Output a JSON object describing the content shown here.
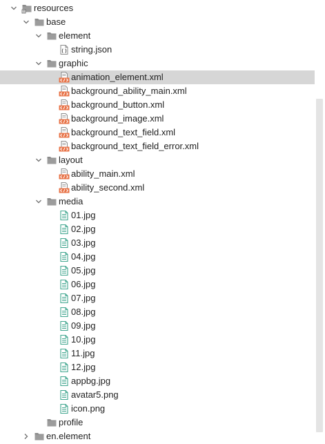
{
  "tree": [
    {
      "label": "resources",
      "level": 0,
      "kind": "folder-root",
      "expanded": true
    },
    {
      "label": "base",
      "level": 1,
      "kind": "folder",
      "expanded": true
    },
    {
      "label": "element",
      "level": 2,
      "kind": "folder",
      "expanded": true
    },
    {
      "label": "string.json",
      "level": 3,
      "kind": "json"
    },
    {
      "label": "graphic",
      "level": 2,
      "kind": "folder",
      "expanded": true
    },
    {
      "label": "animation_element.xml",
      "level": 3,
      "kind": "xml",
      "selected": true
    },
    {
      "label": "background_ability_main.xml",
      "level": 3,
      "kind": "xml"
    },
    {
      "label": "background_button.xml",
      "level": 3,
      "kind": "xml"
    },
    {
      "label": "background_image.xml",
      "level": 3,
      "kind": "xml"
    },
    {
      "label": "background_text_field.xml",
      "level": 3,
      "kind": "xml"
    },
    {
      "label": "background_text_field_error.xml",
      "level": 3,
      "kind": "xml"
    },
    {
      "label": "layout",
      "level": 2,
      "kind": "folder",
      "expanded": true
    },
    {
      "label": "ability_main.xml",
      "level": 3,
      "kind": "xml"
    },
    {
      "label": "ability_second.xml",
      "level": 3,
      "kind": "xml"
    },
    {
      "label": "media",
      "level": 2,
      "kind": "folder",
      "expanded": true
    },
    {
      "label": "01.jpg",
      "level": 3,
      "kind": "image"
    },
    {
      "label": "02.jpg",
      "level": 3,
      "kind": "image"
    },
    {
      "label": "03.jpg",
      "level": 3,
      "kind": "image"
    },
    {
      "label": "04.jpg",
      "level": 3,
      "kind": "image"
    },
    {
      "label": "05.jpg",
      "level": 3,
      "kind": "image"
    },
    {
      "label": "06.jpg",
      "level": 3,
      "kind": "image"
    },
    {
      "label": "07.jpg",
      "level": 3,
      "kind": "image"
    },
    {
      "label": "08.jpg",
      "level": 3,
      "kind": "image"
    },
    {
      "label": "09.jpg",
      "level": 3,
      "kind": "image"
    },
    {
      "label": "10.jpg",
      "level": 3,
      "kind": "image"
    },
    {
      "label": "11.jpg",
      "level": 3,
      "kind": "image"
    },
    {
      "label": "12.jpg",
      "level": 3,
      "kind": "image"
    },
    {
      "label": "appbg.jpg",
      "level": 3,
      "kind": "image"
    },
    {
      "label": "avatar5.png",
      "level": 3,
      "kind": "image"
    },
    {
      "label": "icon.png",
      "level": 3,
      "kind": "image"
    },
    {
      "label": "profile",
      "level": 2,
      "kind": "folder"
    },
    {
      "label": "en.element",
      "level": 1,
      "kind": "folder",
      "expanded": false
    }
  ],
  "icons": {
    "folder-root": "resource-folder-icon",
    "folder": "folder-icon",
    "json": "json-file-icon",
    "xml": "xml-file-icon",
    "image": "image-file-icon"
  },
  "colors": {
    "selection": "#d6d6d6",
    "folder": "#8c8c8c",
    "xml_badge": "#e8754a",
    "image_file": "#3fa58e",
    "text": "#1f1f1f"
  }
}
